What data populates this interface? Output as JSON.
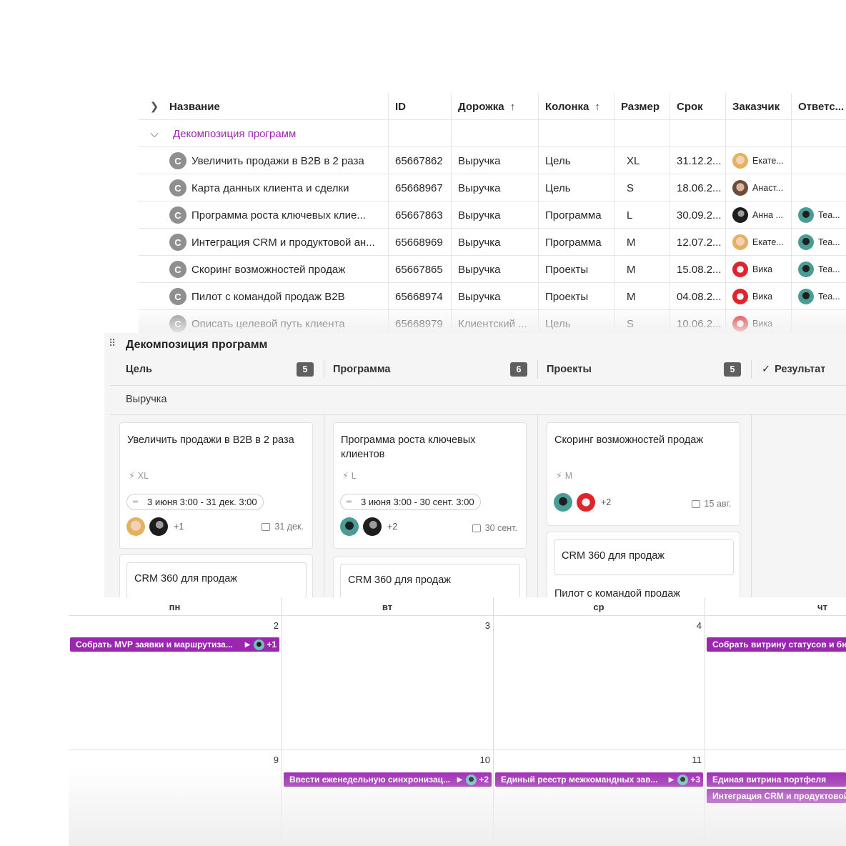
{
  "table": {
    "headers": {
      "name": "Название",
      "id": "ID",
      "lane": "Дорожка",
      "column": "Колонка",
      "size": "Размер",
      "due": "Срок",
      "customer": "Заказчик",
      "owner": "Ответс..."
    },
    "sort_arrow": "↑",
    "expand_icon": "chevron-right-icon",
    "group_icon": "chevron-down-icon",
    "group_label": "Декомпозиция программ",
    "card_type_letter": "C",
    "rows": [
      {
        "name": "Увеличить продажи в B2B в 2 раза",
        "id": "65667862",
        "lane": "Выручка",
        "column": "Цель",
        "size": "XL",
        "due": "31.12.2...",
        "customer": "Екате...",
        "customer_avatar": "blonde",
        "owner": "",
        "owner_avatar": ""
      },
      {
        "name": "Карта данных клиента и сделки",
        "id": "65668967",
        "lane": "Выручка",
        "column": "Цель",
        "size": "S",
        "due": "18.06.2...",
        "customer": "Анаст...",
        "customer_avatar": "brown",
        "owner": "",
        "owner_avatar": ""
      },
      {
        "name": "Программа роста ключевых клие...",
        "id": "65667863",
        "lane": "Выручка",
        "column": "Программа",
        "size": "L",
        "due": "30.09.2...",
        "customer": "Анна ...",
        "customer_avatar": "dark",
        "owner": "Tea...",
        "owner_avatar": "teal"
      },
      {
        "name": "Интеграция CRM и продуктовой ан...",
        "id": "65668969",
        "lane": "Выручка",
        "column": "Программа",
        "size": "M",
        "due": "12.07.2...",
        "customer": "Екате...",
        "customer_avatar": "blonde",
        "owner": "Tea...",
        "owner_avatar": "teal"
      },
      {
        "name": "Скоринг возможностей продаж",
        "id": "65667865",
        "lane": "Выручка",
        "column": "Проекты",
        "size": "M",
        "due": "15.08.2...",
        "customer": "Вика",
        "customer_avatar": "red",
        "owner": "Tea...",
        "owner_avatar": "teal"
      },
      {
        "name": "Пилот с командой продаж B2B",
        "id": "65668974",
        "lane": "Выручка",
        "column": "Проекты",
        "size": "M",
        "due": "04.08.2...",
        "customer": "Вика",
        "customer_avatar": "red",
        "owner": "Tea...",
        "owner_avatar": "teal"
      },
      {
        "name": "Описать целевой путь клиента",
        "id": "65668979",
        "lane": "Клиентский ...",
        "column": "Цель",
        "size": "S",
        "due": "10.06.2...",
        "customer": "Вика",
        "customer_avatar": "red",
        "owner": "",
        "owner_avatar": ""
      }
    ]
  },
  "board": {
    "title": "Декомпозиция программ",
    "columns": [
      {
        "name": "Цель",
        "count": "5"
      },
      {
        "name": "Программа",
        "count": "6"
      },
      {
        "name": "Проекты",
        "count": "5"
      }
    ],
    "result_label": "Результат",
    "result_icon": "check-icon",
    "lane": "Выручка",
    "cards": [
      {
        "title": "Увеличить продажи в B2B в 2 раза",
        "size": "XL",
        "dates": "3 июня 3:00 - 31 дек. 3:00",
        "plus": "+1",
        "due": "31 дек.",
        "avatars": [
          "blonde",
          "dark"
        ]
      },
      {
        "title": "Программа роста ключевых клиентов",
        "size": "L",
        "dates": "3 июня 3:00 - 30 сент. 3:00",
        "plus": "+2",
        "due": "30 сент.",
        "avatars": [
          "teal",
          "dark"
        ]
      },
      {
        "title": "Скоринг возможностей продаж",
        "size": "M",
        "dates": "",
        "plus": "+2",
        "due": "15 авг.",
        "avatars": [
          "teal",
          "red"
        ]
      }
    ],
    "sub_cards": [
      "CRM 360 для продаж",
      "CRM 360 для продаж",
      "CRM 360 для продаж",
      "Пилот с командой продаж"
    ]
  },
  "calendar": {
    "days": [
      "пн",
      "вт",
      "ср",
      "чт"
    ],
    "week1": [
      "2",
      "3",
      "4"
    ],
    "week2": [
      "9",
      "10",
      "11"
    ],
    "events": [
      {
        "label": "Собрать MVP заявки и маршрутиза...",
        "plus": "+1"
      },
      {
        "label": "Собрать витрину статусов и бюд",
        "plus": ""
      },
      {
        "label": "Ввести еженедельную синхронизац...",
        "plus": "+2"
      },
      {
        "label": "Единый реестр межкомандных зав...",
        "plus": "+3"
      },
      {
        "label": "Единая витрина портфеля",
        "plus": ""
      },
      {
        "label": "Интеграция CRM и продуктовой",
        "plus": ""
      }
    ],
    "colors": {
      "event": "#9b27b0",
      "group": "#9b27b0"
    }
  }
}
